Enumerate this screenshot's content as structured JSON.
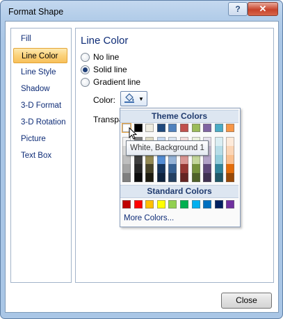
{
  "window": {
    "title": "Format Shape",
    "help_label": "?",
    "close_label": "✕"
  },
  "nav": {
    "items": [
      {
        "label": "Fill",
        "selected": false
      },
      {
        "label": "Line Color",
        "selected": true
      },
      {
        "label": "Line Style",
        "selected": false
      },
      {
        "label": "Shadow",
        "selected": false
      },
      {
        "label": "3-D Format",
        "selected": false
      },
      {
        "label": "3-D Rotation",
        "selected": false
      },
      {
        "label": "Picture",
        "selected": false
      },
      {
        "label": "Text Box",
        "selected": false
      }
    ]
  },
  "panel": {
    "heading": "Line Color",
    "options": [
      {
        "label": "No line",
        "checked": false
      },
      {
        "label": "Solid line",
        "checked": true
      },
      {
        "label": "Gradient line",
        "checked": false
      }
    ],
    "color_label": "Color:",
    "transparency_label": "Transpa",
    "color_icon": "paint-bucket-icon"
  },
  "picker": {
    "theme_header": "Theme Colors",
    "standard_header": "Standard Colors",
    "more_colors": "More Colors...",
    "tooltip": "White, Background 1",
    "theme_colors": [
      "#ffffff",
      "#000000",
      "#eeece1",
      "#1f497d",
      "#4f81bd",
      "#c0504d",
      "#9bbb59",
      "#8064a2",
      "#4bacc6",
      "#f79646"
    ],
    "theme_shades": [
      [
        "#f2f2f2",
        "#d8d8d8",
        "#bfbfbf",
        "#a5a5a5",
        "#7f7f7f"
      ],
      [
        "#7f7f7f",
        "#595959",
        "#3f3f3f",
        "#262626",
        "#0c0c0c"
      ],
      [
        "#ddd9c3",
        "#c4bd97",
        "#938953",
        "#494429",
        "#1d1b10"
      ],
      [
        "#c6d9f0",
        "#8db3e2",
        "#548dd4",
        "#17365d",
        "#0f243e"
      ],
      [
        "#dbe5f1",
        "#b8cce4",
        "#95b3d7",
        "#366092",
        "#244061"
      ],
      [
        "#f2dcdb",
        "#e5b9b7",
        "#d99694",
        "#953734",
        "#632423"
      ],
      [
        "#ebf1dd",
        "#d7e3bc",
        "#c3d69b",
        "#76923c",
        "#4f6128"
      ],
      [
        "#e5e0ec",
        "#ccc1d9",
        "#b2a2c7",
        "#5f497a",
        "#3f3151"
      ],
      [
        "#dbeef3",
        "#b7dde8",
        "#92cddc",
        "#31859b",
        "#205867"
      ],
      [
        "#fdeada",
        "#fbd5b5",
        "#fac08f",
        "#e36c09",
        "#974806"
      ]
    ],
    "standard_colors": [
      "#c00000",
      "#ff0000",
      "#ffc000",
      "#ffff00",
      "#92d050",
      "#00b050",
      "#00b0f0",
      "#0070c0",
      "#002060",
      "#7030a0"
    ],
    "selected_index": 0
  },
  "footer": {
    "close_label": "Close"
  }
}
